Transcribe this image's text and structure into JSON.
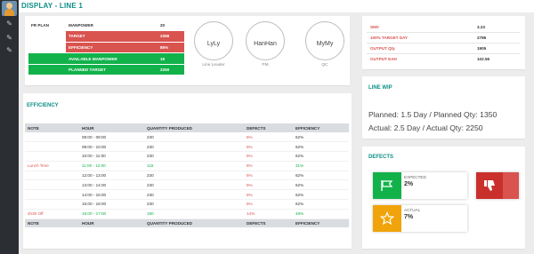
{
  "header": {
    "title": "DISPLAY - LINE 1"
  },
  "sidebar": {
    "icons": [
      "avatar",
      "pencil-icon",
      "pencil-icon",
      "pencil-icon"
    ]
  },
  "plan": {
    "label": "FR PLAN",
    "rows": [
      {
        "key": "MANPOWER",
        "value": "20"
      },
      {
        "key": "TARGET",
        "value": "2368"
      },
      {
        "key": "EFFICIENCY",
        "value": "85%"
      },
      {
        "key": "AVAILABLE MANPOWER",
        "value": "19"
      },
      {
        "key": "PLANNED TARGET",
        "value": "2250"
      }
    ]
  },
  "people": [
    {
      "name": "LyLy",
      "role": "Line Leader"
    },
    {
      "name": "HanHan",
      "role": "PM"
    },
    {
      "name": "MyMy",
      "role": "QC"
    }
  ],
  "stats": [
    {
      "key": "SMV",
      "value": "3.23"
    },
    {
      "key": "100% TARGET DAY",
      "value": "2786"
    },
    {
      "key": "OUTPUT Qty",
      "value": "1905"
    },
    {
      "key": "OUTPUT EAH",
      "value": "102.55"
    }
  ],
  "efficiency": {
    "title": "EFFICIENCY",
    "headers": [
      "NOTE",
      "HOUR",
      "QUANTITY PRODUCED",
      "DEFECTS",
      "EFFICIENCY"
    ],
    "rows": [
      {
        "note": "",
        "hour": "08:00 - 09:00",
        "qty": "230",
        "defects": "6%",
        "eff": "62%"
      },
      {
        "note": "",
        "hour": "09:00 - 10:00",
        "qty": "230",
        "defects": "5%",
        "eff": "62%"
      },
      {
        "note": "",
        "hour": "10:00 - 11:00",
        "qty": "230",
        "defects": "5%",
        "eff": "62%"
      },
      {
        "note": "Lunch Time",
        "hour": "11:00 - 12:00",
        "qty": "115",
        "defects": "6%",
        "eff": "31%"
      },
      {
        "note": "",
        "hour": "12:00 - 13:00",
        "qty": "230",
        "defects": "5%",
        "eff": "62%"
      },
      {
        "note": "",
        "hour": "13:00 - 14:00",
        "qty": "230",
        "defects": "5%",
        "eff": "62%"
      },
      {
        "note": "",
        "hour": "14:00 - 15:00",
        "qty": "230",
        "defects": "5%",
        "eff": "62%"
      },
      {
        "note": "",
        "hour": "15:00 - 16:00",
        "qty": "230",
        "defects": "5%",
        "eff": "62%"
      },
      {
        "note": "4h30 Off",
        "hour": "16:00 - 17:00",
        "qty": "180",
        "defects": "14%",
        "eff": "48%"
      }
    ],
    "footer": [
      "NOTE",
      "HOUR",
      "QUANTITY PRODUCED",
      "DEFECTS",
      "EFFICIENCY"
    ]
  },
  "wip": {
    "title": "LINE WIP",
    "planned": "Planned: 1.5 Day / Planned Qty: 1350",
    "actual": "Actual: 2.5 Day / Actual Qty: 2250"
  },
  "defects": {
    "title": "DEFECTS",
    "expected_label": "EXPECTED",
    "expected_value": "2%",
    "actual_label": "ACTUAL",
    "actual_value": "7%"
  },
  "colors": {
    "teal": "#0e8f86",
    "red": "#d9534f",
    "green": "#12b24b",
    "orange": "#f0a30a",
    "dark": "#2b2f33"
  }
}
